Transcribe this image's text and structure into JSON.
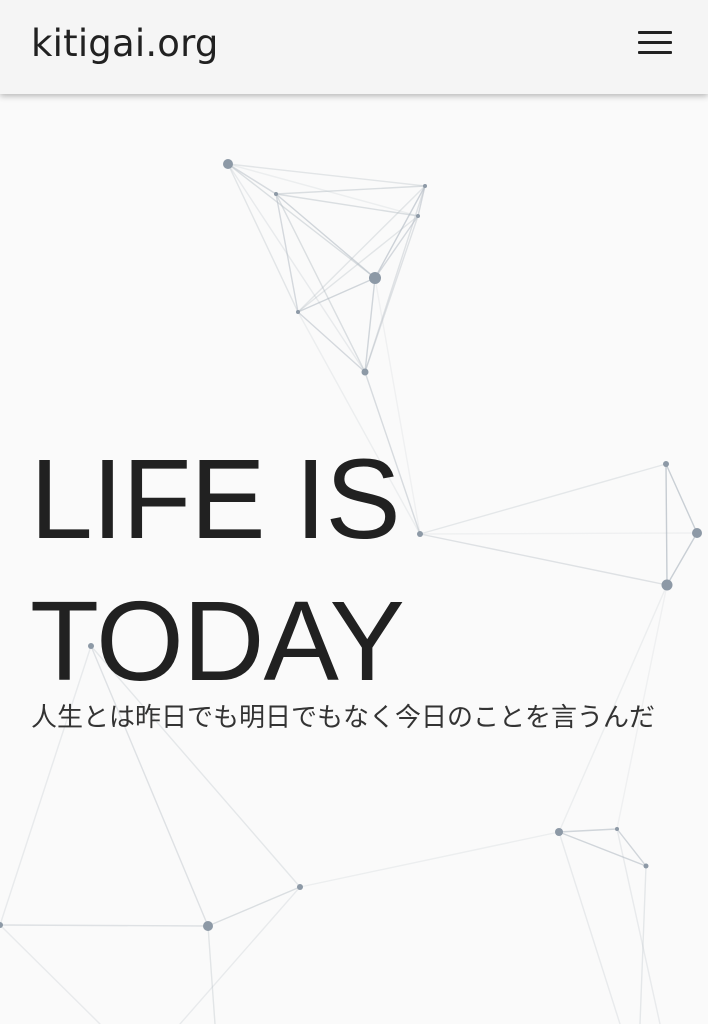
{
  "header": {
    "site_title": "kitigai.org",
    "menu_icon": "hamburger-menu-icon"
  },
  "hero": {
    "title_line1": "LIFE IS",
    "title_line2": "TODAY",
    "subtitle": "人生とは昨日でも明日でもなく今日のことを言うんだ"
  },
  "colors": {
    "background": "#fafafa",
    "header_background": "#f5f5f5",
    "text": "#212121",
    "network_node": "#8d99a6",
    "network_line": "#b4bcc4"
  }
}
